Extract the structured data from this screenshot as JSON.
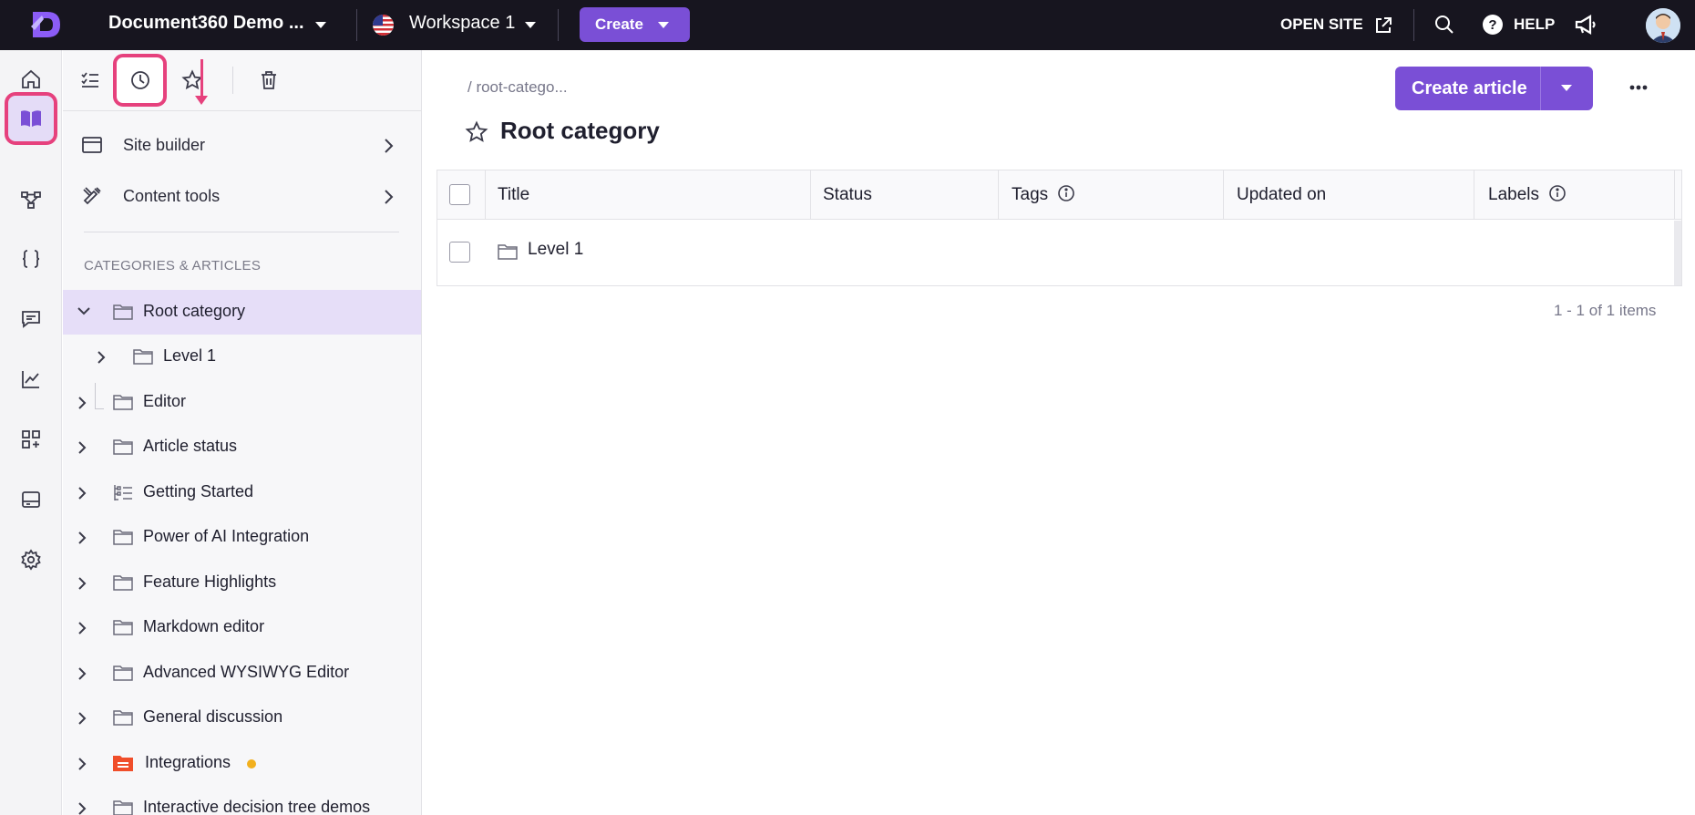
{
  "topbar": {
    "project_name": "Document360 Demo ...",
    "workspace": "Workspace 1",
    "create_label": "Create",
    "open_site_label": "OPEN SITE",
    "help_label": "HELP"
  },
  "rail": {
    "items": [
      "home-icon",
      "book-icon",
      "workflow-icon",
      "code-braces-icon",
      "feedback-icon",
      "analytics-icon",
      "integrations-icon",
      "widget-icon",
      "settings-icon"
    ],
    "active": "book-icon"
  },
  "sidebar": {
    "toolbar": [
      "checklist-icon",
      "clock-icon",
      "star-icon",
      "trash-icon"
    ],
    "menu": [
      {
        "label": "Site builder"
      },
      {
        "label": "Content tools"
      }
    ],
    "section_title": "CATEGORIES & ARTICLES",
    "tree": [
      {
        "label": "Root category",
        "expanded": true,
        "selected": true
      },
      {
        "label": "Level 1",
        "indent": 1
      },
      {
        "label": "Editor"
      },
      {
        "label": "Article status"
      },
      {
        "label": "Getting Started",
        "icon": "page-list-icon"
      },
      {
        "label": "Power of AI Integration"
      },
      {
        "label": "Feature Highlights"
      },
      {
        "label": "Markdown editor"
      },
      {
        "label": "Advanced WYSIWYG Editor"
      },
      {
        "label": "General discussion"
      },
      {
        "label": "Integrations",
        "icon": "colored-folder-icon",
        "dot_color": "#f2b01e"
      },
      {
        "label": "Interactive decision tree demos"
      }
    ]
  },
  "main": {
    "breadcrumb": "/ root-catego...",
    "title": "Root category",
    "create_article_label": "Create article",
    "columns": [
      "Title",
      "Status",
      "Tags",
      "Updated on",
      "Labels"
    ],
    "rows": [
      {
        "title": "Level 1"
      }
    ],
    "pager": "1 - 1 of 1 items"
  },
  "colors": {
    "accent": "#7a4fd6",
    "highlight": "#e6417d",
    "topbar": "#17151f",
    "selected_row": "#e6def8"
  }
}
